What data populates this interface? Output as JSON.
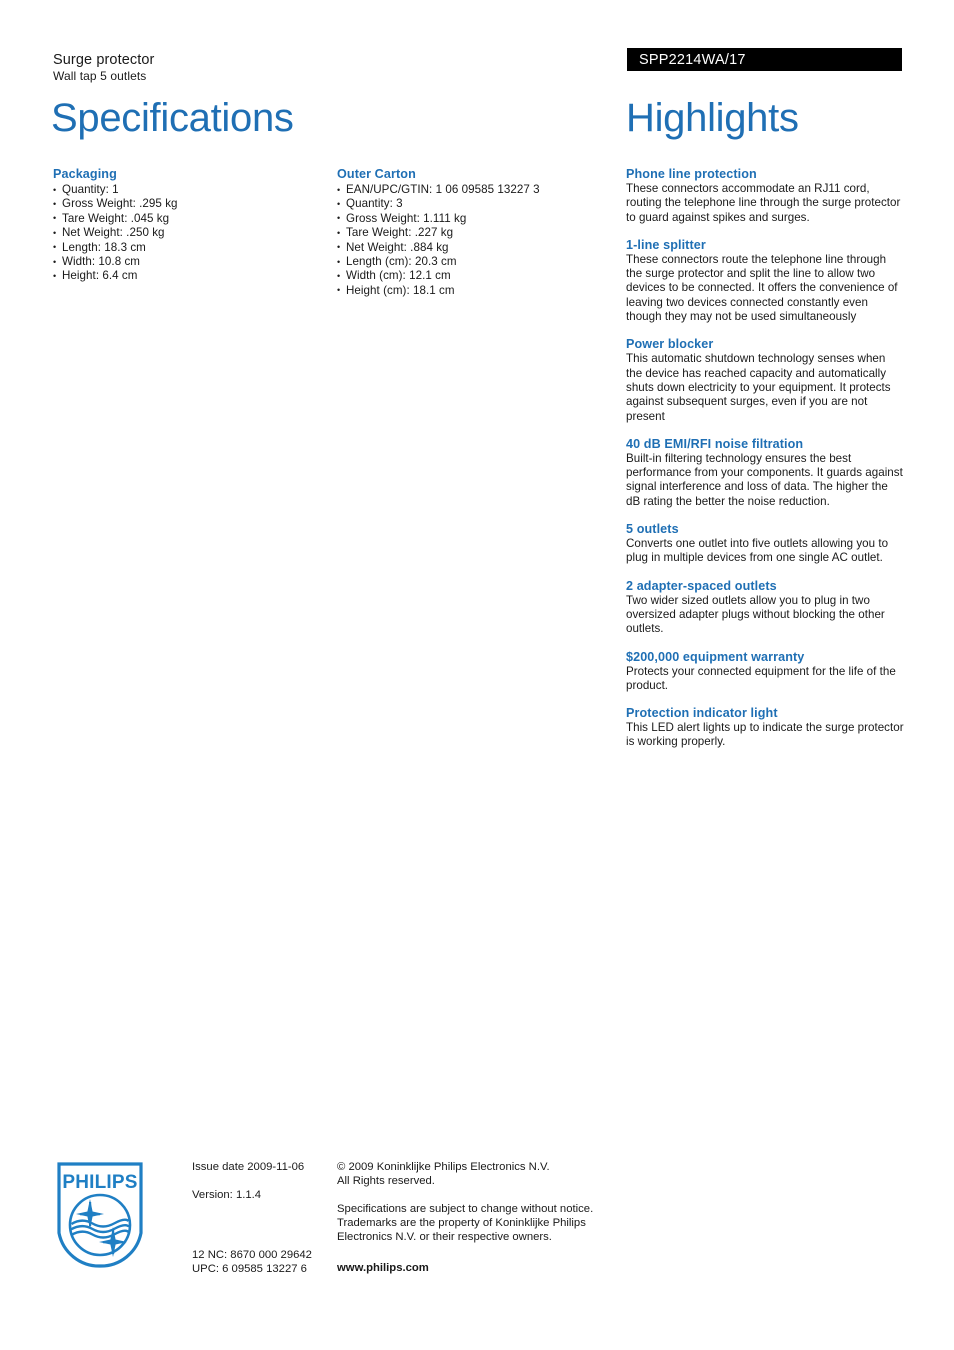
{
  "header": {
    "product_title": "Surge protector",
    "product_subtitle": "Wall tap 5 outlets",
    "product_code": "SPP2214WA/17"
  },
  "titles": {
    "specifications": "Specifications",
    "highlights": "Highlights"
  },
  "colors": {
    "accent_blue": "#1f6fb4",
    "code_bar_bg": "#000000",
    "text": "#1a1a1a"
  },
  "specs": {
    "packaging": {
      "heading": "Packaging",
      "items": [
        "Quantity: 1",
        "Gross Weight: .295 kg",
        "Tare Weight: .045 kg",
        "Net Weight: .250 kg",
        "Length: 18.3 cm",
        "Width: 10.8 cm",
        "Height: 6.4 cm"
      ]
    },
    "outer_carton": {
      "heading": "Outer Carton",
      "items": [
        "EAN/UPC/GTIN: 1 06 09585 13227 3",
        "Quantity: 3",
        "Gross Weight: 1.111 kg",
        "Tare Weight: .227 kg",
        "Net Weight: .884 kg",
        "Length (cm): 20.3 cm",
        "Width (cm): 12.1 cm",
        "Height (cm): 18.1 cm"
      ]
    }
  },
  "highlights": [
    {
      "title": "Phone line protection",
      "body": "These connectors accommodate an RJ11 cord, routing the telephone line through the surge protector to guard against spikes and surges."
    },
    {
      "title": "1-line splitter",
      "body": "These connectors route the telephone line through the surge protector and split the line to allow two devices to be connected. It offers the convenience of leaving two devices connected constantly even though they may not be used simultaneously"
    },
    {
      "title": "Power blocker",
      "body": "This automatic shutdown technology senses when the device has reached capacity and automatically shuts down electricity to your equipment. It protects against subsequent surges, even if you are not present"
    },
    {
      "title": "40 dB EMI/RFI noise filtration",
      "body": "Built-in filtering technology ensures the best performance from your components. It guards against signal interference and loss of data. The higher the dB rating the better the noise reduction."
    },
    {
      "title": "5 outlets",
      "body": "Converts one outlet into five outlets allowing you to plug in multiple devices from one single AC outlet."
    },
    {
      "title": "2 adapter-spaced outlets",
      "body": "Two wider sized outlets allow you to plug in two oversized adapter plugs without blocking the other outlets."
    },
    {
      "title": "$200,000 equipment warranty",
      "body": "Protects your connected equipment for the life of the product."
    },
    {
      "title": "Protection indicator light",
      "body": "This LED alert lights up to indicate the surge protector is working properly."
    }
  ],
  "footer": {
    "logo_wordmark": "PHILIPS",
    "issue_date": "Issue date 2009-11-06",
    "version": "Version: 1.1.4",
    "nc": "12 NC: 8670 000 29642",
    "upc": "UPC: 6 09585 13227 6",
    "copyright_line1": "© 2009 Koninklijke Philips Electronics N.V.",
    "copyright_line2": "All Rights reserved.",
    "disclaimer_line1": "Specifications are subject to change without notice.",
    "disclaimer_line2": "Trademarks are the property of Koninklijke Philips",
    "disclaimer_line3": "Electronics N.V. or their respective owners.",
    "website": "www.philips.com"
  }
}
